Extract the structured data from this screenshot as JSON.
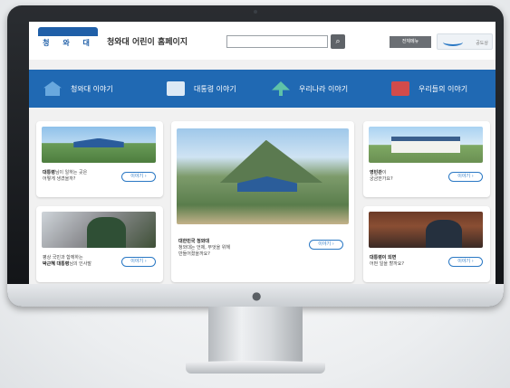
{
  "header": {
    "site_title": "청와대 어린이 홈페이지",
    "logo_text": "청 와 대",
    "search": {
      "value": "",
      "placeholder": ""
    },
    "all_menu_label": "전체메뉴",
    "partner_label": "공도상"
  },
  "nav": {
    "items": [
      {
        "label": "청와대 이야기",
        "icon": "house-icon"
      },
      {
        "label": "대통령 이야기",
        "icon": "book-icon"
      },
      {
        "label": "우리나라 이야기",
        "icon": "tree-icon"
      },
      {
        "label": "우리들의 이야기",
        "icon": "box-icon"
      }
    ]
  },
  "cards": {
    "left_top": {
      "line1_bold": "대통령",
      "line1": "님이 일하는 곳은",
      "line2": "어떻게 생겼을까?",
      "button": "이야기"
    },
    "left_bottom": {
      "line1": "평상 국민과 함께하는",
      "line2_bold": "박근혜 대통령",
      "line2": "님의 인사말",
      "button": "이야기"
    },
    "center": {
      "line1": "대한민국 청와대",
      "line2": "청와대는 언제, 무엇을 위해",
      "line3": "만들어졌을까요?",
      "button": "이야기"
    },
    "right_top": {
      "line1_bold": "영빈관",
      "line1": "이",
      "line2": "궁금한가요?",
      "button": "이야기"
    },
    "right_bottom": {
      "line1_bold": "대통령이 되면",
      "line2": "어떤 일을 할까요?",
      "button": "이야기"
    }
  },
  "colors": {
    "nav_blue": "#2069b3",
    "accent_blue": "#2a78c4",
    "bezel": "#1a1c1f"
  }
}
